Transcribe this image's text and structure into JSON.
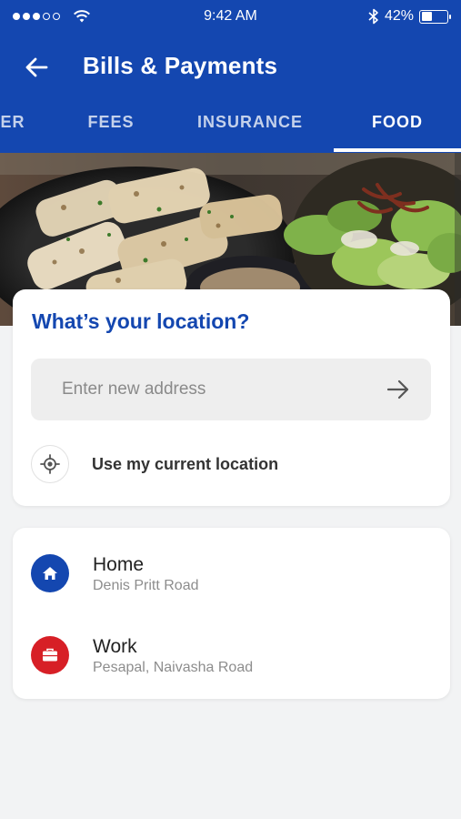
{
  "status_bar": {
    "time": "9:42 AM",
    "battery_percent": "42%",
    "battery_level": 0.42,
    "signal_bars_filled": 3,
    "signal_bars_total": 5,
    "icons": [
      "signal-dots-icon",
      "wifi-icon",
      "bluetooth-icon",
      "battery-icon"
    ]
  },
  "header": {
    "title": "Bills & Payments",
    "back_icon": "back-arrow-icon"
  },
  "tabs": [
    {
      "label": "ER",
      "active": false
    },
    {
      "label": "FEES",
      "active": false
    },
    {
      "label": "INSURANCE",
      "active": false
    },
    {
      "label": "FOOD",
      "active": true
    }
  ],
  "location": {
    "title": "What’s your location?",
    "address_placeholder": "Enter new address",
    "address_value": "",
    "submit_icon": "arrow-right-icon",
    "current_location_label": "Use my current location",
    "current_location_icon": "gps-target-icon"
  },
  "saved_locations": [
    {
      "name": "Home",
      "address": "Denis Pritt Road",
      "icon": "home-icon",
      "color": "#1447b0"
    },
    {
      "name": "Work",
      "address": "Pesapal, Naivasha Road",
      "icon": "briefcase-icon",
      "color": "#d71f26"
    }
  ],
  "colors": {
    "primary": "#1447b0",
    "accent_red": "#d71f26",
    "background": "#f2f3f4",
    "card": "#ffffff"
  }
}
